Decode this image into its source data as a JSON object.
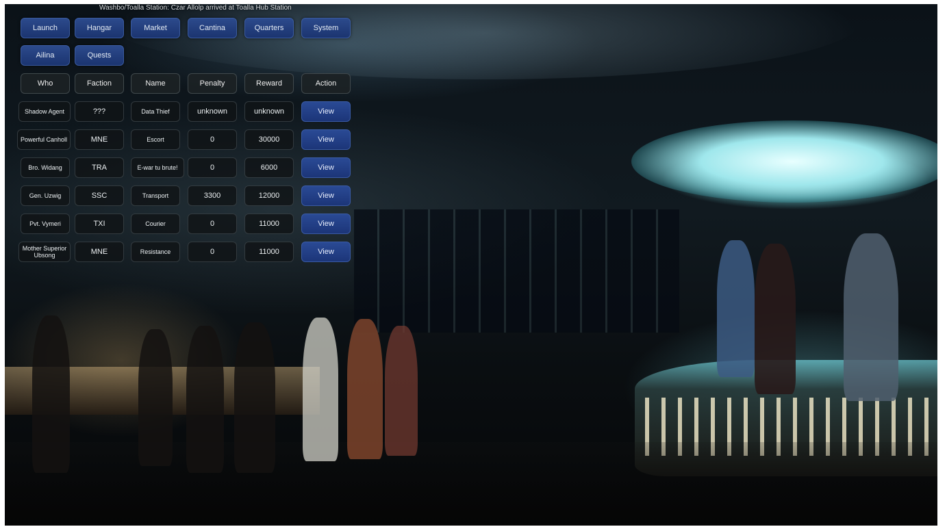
{
  "status_message": "Washbo/Toalla Station: Czar Allolp arrived at Toalla Hub Station",
  "nav": {
    "row1": [
      "Launch",
      "Hangar",
      "Market",
      "Cantina",
      "Quarters",
      "System"
    ],
    "row2": [
      "Ailina",
      "Quests"
    ]
  },
  "table": {
    "headers": [
      "Who",
      "Faction",
      "Name",
      "Penalty",
      "Reward",
      "Action"
    ],
    "rows": [
      {
        "who": "Shadow Agent",
        "faction": "???",
        "name": "Data Thief",
        "penalty": "unknown",
        "reward": "unknown",
        "action": "View"
      },
      {
        "who": "Powerful Canholl",
        "faction": "MNE",
        "name": "Escort",
        "penalty": "0",
        "reward": "30000",
        "action": "View"
      },
      {
        "who": "Bro. Widang",
        "faction": "TRA",
        "name": "E-war tu brute!",
        "penalty": "0",
        "reward": "6000",
        "action": "View"
      },
      {
        "who": "Gen. Uzwig",
        "faction": "SSC",
        "name": "Transport",
        "penalty": "3300",
        "reward": "12000",
        "action": "View"
      },
      {
        "who": "Pvt. Vymeri",
        "faction": "TXI",
        "name": "Courier",
        "penalty": "0",
        "reward": "11000",
        "action": "View"
      },
      {
        "who": "Mother Superior Ubsong",
        "faction": "MNE",
        "name": "Resistance",
        "penalty": "0",
        "reward": "11000",
        "action": "View"
      }
    ]
  },
  "colors": {
    "nav_button": "#1f3b7a",
    "view_button": "#1f3b7e",
    "cell_bg": "#101416",
    "stage_glow": "#9fe7ec"
  }
}
